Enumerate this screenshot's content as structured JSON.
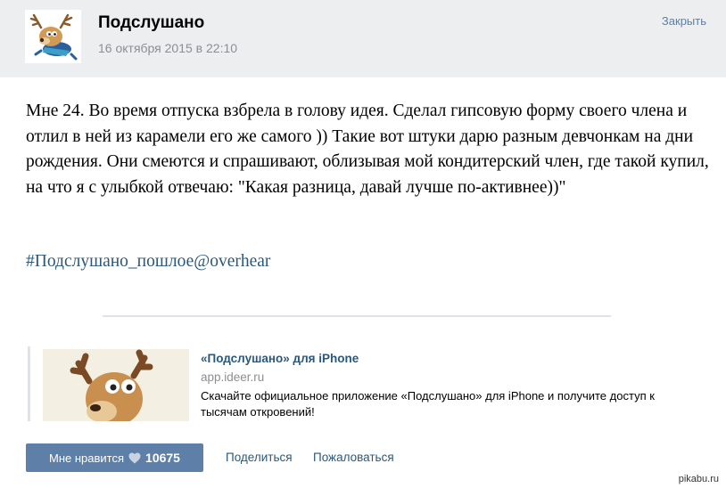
{
  "header": {
    "title": "Подслушано",
    "date": "16 октября 2015 в 22:10",
    "close_label": "Закрыть"
  },
  "post": {
    "text": "Мне 24. Во время отпуска взбрела в голову идея. Сделал гипсовую форму своего члена и отлил в ней из карамели его же самого )) Такие вот штуки дарю разным девчонкам на дни рождения. Они смеются и спрашивают, облизывая мой кондитерский член, где такой купил, на что я с улыбкой отвечаю: \"Какая разница, давай лучше по-активнее))\"",
    "hashtag": "#Подслушано_пошлое@overhear"
  },
  "attachment": {
    "title": "«Подслушано» для iPhone",
    "domain": "app.ideer.ru",
    "description": "Скачайте официальное приложение «Подслушано» для iPhone и получите доступ к тысячам откровений!"
  },
  "actions": {
    "like_label": "Мне нравится",
    "like_count": "10675",
    "share_label": "Поделиться",
    "report_label": "Пожаловаться"
  },
  "watermark": "pikabu.ru",
  "colors": {
    "header_bg": "#edeef0",
    "link": "#2b587a",
    "button": "#5e80a8",
    "muted": "#8c8e91"
  },
  "icons": [
    "deer-avatar",
    "deer-thumbnail",
    "heart-icon"
  ]
}
